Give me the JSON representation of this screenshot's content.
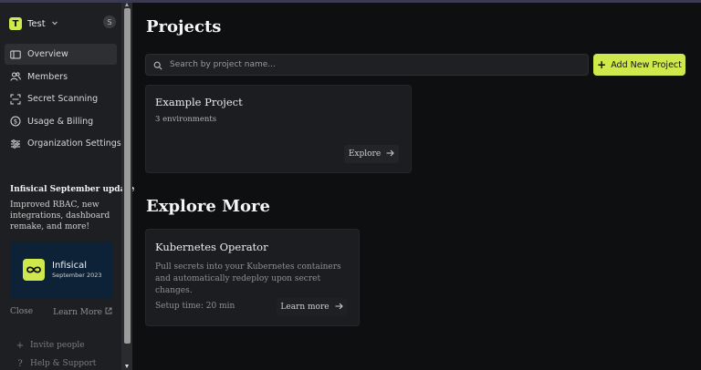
{
  "sidebar": {
    "org": {
      "logo_letter": "T",
      "name": "Test"
    },
    "user_initial": "S",
    "nav": [
      {
        "label": "Overview",
        "icon": "overview-icon"
      },
      {
        "label": "Members",
        "icon": "members-icon"
      },
      {
        "label": "Secret Scanning",
        "icon": "scan-icon"
      },
      {
        "label": "Usage & Billing",
        "icon": "billing-icon"
      },
      {
        "label": "Organization Settings",
        "icon": "settings-sliders-icon"
      }
    ],
    "update": {
      "title": "Infisical September update",
      "text": "Improved RBAC, new integrations, dashboard remake, and more!",
      "card_brand": "Infisical",
      "card_date": "September 2023",
      "close_label": "Close",
      "learn_more_label": "Learn More"
    },
    "footer": [
      {
        "label": "Invite people",
        "icon": "plus-icon"
      },
      {
        "label": "Help & Support",
        "icon": "question-icon"
      }
    ]
  },
  "main": {
    "title": "Projects",
    "search_placeholder": "Search by project name...",
    "add_button_label": "Add New Project",
    "projects": [
      {
        "name": "Example Project",
        "environments": "3 environments",
        "explore_label": "Explore"
      }
    ],
    "explore_more": {
      "title": "Explore More",
      "cards": [
        {
          "title": "Kubernetes Operator",
          "description": "Pull secrets into your Kubernetes containers and automatically redeploy upon secret changes.",
          "setup_time": "Setup time: 20 min",
          "button_label": "Learn more"
        }
      ]
    }
  },
  "colors": {
    "accent": "#cfe94c",
    "background": "#0e0f11",
    "sidebar": "#1e1f22"
  }
}
